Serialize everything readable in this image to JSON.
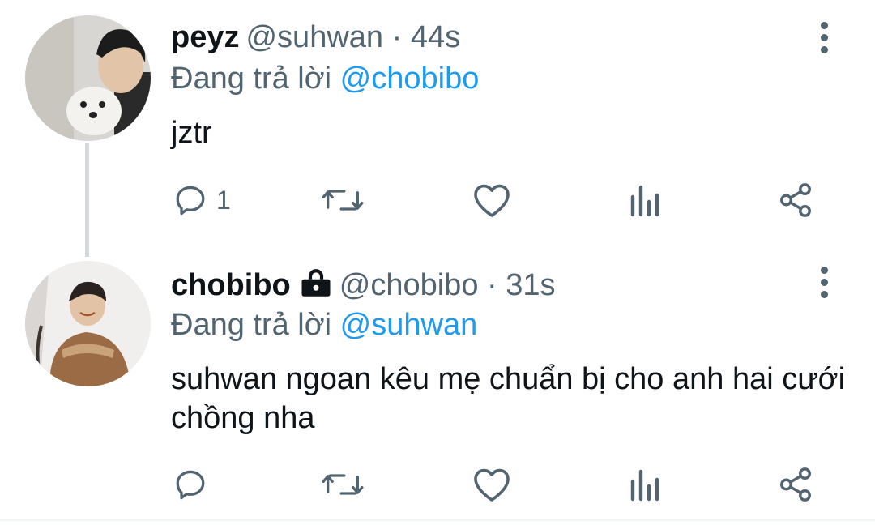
{
  "tweets": [
    {
      "name": "peyz",
      "handle": "@suhwan",
      "time": "44s",
      "reply_prefix": "Đang trả lời",
      "reply_to": "@chobibo",
      "text": "jztr",
      "reply_count": "1",
      "locked": false
    },
    {
      "name": "chobibo",
      "handle": "@chobibo",
      "time": "31s",
      "reply_prefix": "Đang trả lời",
      "reply_to": "@suhwan",
      "text": "suhwan ngoan kêu mẹ chuẩn bị cho anh hai cưới chồng nha",
      "reply_count": "",
      "locked": true
    }
  ],
  "separator": "·",
  "icons": [
    "reply-icon",
    "retweet-icon",
    "like-icon",
    "analytics-icon",
    "share-icon",
    "more-vertical-icon",
    "lock-icon"
  ],
  "colors": {
    "text": "#0f1419",
    "secondary": "#536471",
    "link": "#1d9bf0"
  }
}
